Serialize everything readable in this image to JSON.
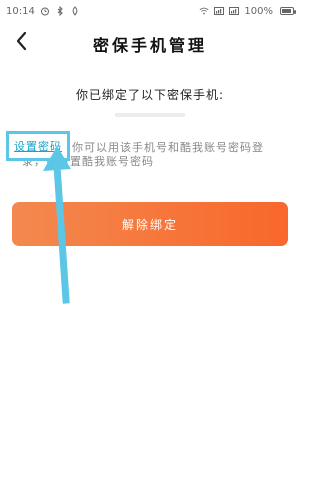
{
  "status_bar": {
    "time": "10:14",
    "battery": "100%"
  },
  "nav": {
    "title": "密保手机管理",
    "back_icon": "chevron-left-icon"
  },
  "content": {
    "info_text": "你已绑定了以下密保手机:",
    "hint_text": "你可以用该手机号和酷我账号密码登录，或重置酷我账号密码",
    "set_password_label": "设置密码"
  },
  "actions": {
    "unbind_label": "解除绑定"
  },
  "colors": {
    "accent": "#f9672b",
    "button_gradient_start": "#f3894f",
    "annotation": "#5cc6e6"
  }
}
